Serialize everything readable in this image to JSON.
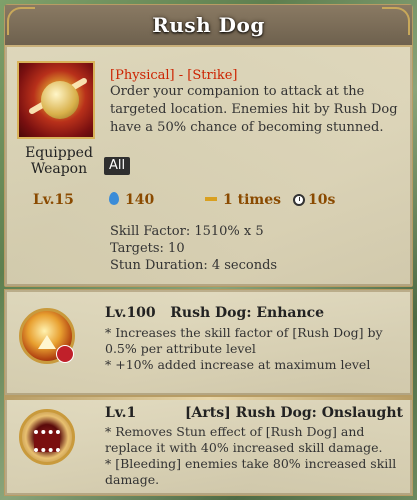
{
  "skill": {
    "name": "Rush Dog",
    "tags": "[Physical] - [Strike]",
    "description": "Order your companion to attack at the targeted location. Enemies hit by Rush Dog have a 50% chance of becoming stunned.",
    "equip_label": "Equipped Weapon",
    "equip_badge": "All",
    "level": "Lv.15",
    "mana": "140",
    "times": "1 times",
    "cooldown": "10s",
    "details": {
      "skill_factor": "Skill Factor: 1510% x 5",
      "targets": "Targets: 10",
      "stun_duration": "Stun Duration: 4 seconds"
    }
  },
  "enhancements": [
    {
      "level": "Lv.100",
      "name": "Rush Dog: Enhance",
      "lines": [
        "* Increases the skill factor of [Rush Dog] by 0.5% per attribute level",
        "* +10% added increase at maximum level"
      ]
    },
    {
      "level": "Lv.1",
      "name": "[Arts] Rush Dog: Onslaught",
      "lines": [
        "* Removes Stun effect of [Rush Dog] and replace it with 40% increased skill damage.",
        "* [Bleeding] enemies take 80% increased skill damage."
      ]
    }
  ],
  "icons": {
    "skill": "rush-dog-skill-icon",
    "mana": "mana-drop-icon",
    "times": "uses-bar-icon",
    "cooldown": "clock-icon",
    "enhance1": "enhance-arrow-icon",
    "enhance2": "monster-jaws-icon"
  },
  "colors": {
    "tags": "#cc2200",
    "stat_text": "#8a4a00",
    "title": "#ffffff"
  }
}
